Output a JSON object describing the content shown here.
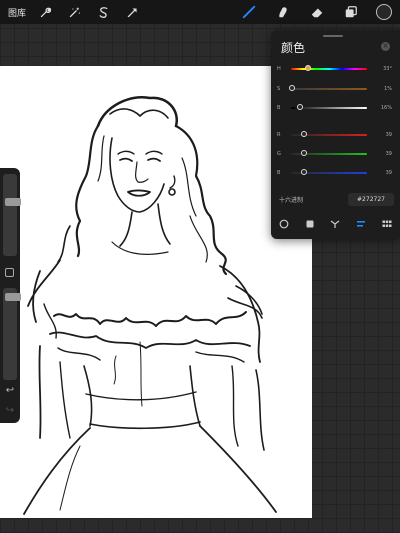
{
  "topbar": {
    "gallery_label": "图库",
    "left_tools": [
      "wrench-icon",
      "magic-wand-icon",
      "selection-s-icon",
      "transform-arrow-icon"
    ],
    "right_tools": [
      "brush-icon",
      "smudge-icon",
      "eraser-icon",
      "layers-icon"
    ],
    "current_color": "#272727",
    "accent_color": "#1f8bff"
  },
  "color_panel": {
    "title": "颜色",
    "hsb": [
      {
        "label": "H",
        "value": "33°",
        "fraction": 0.2
      },
      {
        "label": "S",
        "value": "1%",
        "fraction": 0.01
      },
      {
        "label": "B",
        "value": "16%",
        "fraction": 0.16
      }
    ],
    "rgb": [
      {
        "label": "R",
        "value": "39",
        "fraction": 0.15
      },
      {
        "label": "G",
        "value": "39",
        "fraction": 0.15
      },
      {
        "label": "B",
        "value": "39",
        "fraction": 0.15
      }
    ],
    "hex_label": "十六进制",
    "hex_value": "#272727",
    "modes": [
      "disc-icon",
      "classic-square-icon",
      "harmony-icon",
      "value-sliders-icon",
      "palettes-grid-icon"
    ],
    "active_mode": "value-sliders-icon"
  },
  "sidebar": {
    "brush_size_level": 0.35,
    "opacity_level": 0.1,
    "undo_icon": "undo-icon",
    "redo_icon": "redo-icon"
  }
}
